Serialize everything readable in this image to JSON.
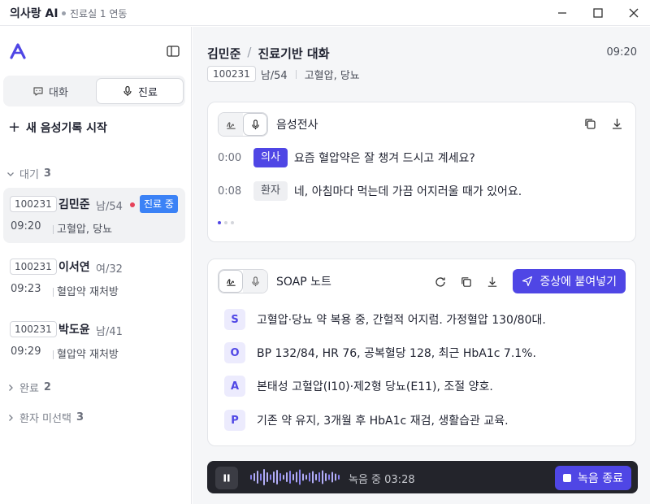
{
  "titlebar": {
    "app_name": "의사랑 AI",
    "location": "진료실 1 연동"
  },
  "sidebar": {
    "tabs": [
      {
        "label": "대화"
      },
      {
        "label": "진료"
      }
    ],
    "new_record_label": "새 음성기록 시작",
    "groups": {
      "waiting": {
        "label": "대기",
        "count": "3"
      },
      "done": {
        "label": "완료",
        "count": "2"
      },
      "unselected": {
        "label": "환자 미선택",
        "count": "3"
      }
    },
    "patients": [
      {
        "id": "100231",
        "name": "김민준",
        "meta": "남/54",
        "time": "09:20",
        "diag": "고혈압, 당뇨",
        "badge": "진료 중"
      },
      {
        "id": "100231",
        "name": "이서연",
        "meta": "여/32",
        "time": "09:23",
        "diag": "혈압약 재처방"
      },
      {
        "id": "100231",
        "name": "박도윤",
        "meta": "남/41",
        "time": "09:29",
        "diag": "혈압약 재처방"
      }
    ]
  },
  "header": {
    "patient_name": "김민준",
    "section": "진료기반 대화",
    "time": "09:20",
    "patient_id": "100231",
    "meta": "남/54",
    "diag": "고혈압, 당뇨"
  },
  "transcript": {
    "title": "음성전사",
    "lines": [
      {
        "time": "0:00",
        "speaker": "의사",
        "text": "요즘 혈압약은 잘 챙겨 드시고 계세요?"
      },
      {
        "time": "0:08",
        "speaker": "환자",
        "text": "네, 아침마다 먹는데 가끔 어지러울 때가 있어요."
      }
    ]
  },
  "soap": {
    "title": "SOAP 노트",
    "paste_label": "증상에 붙여넣기",
    "rows": [
      {
        "letter": "S",
        "text": "고혈압·당뇨 약 복용 중, 간헐적 어지럼. 가정혈압 130/80대."
      },
      {
        "letter": "O",
        "text": "BP 132/84, HR 76, 공복혈당 128, 최근 HbA1c 7.1%."
      },
      {
        "letter": "A",
        "text": "본태성 고혈압(I10)·제2형 당뇨(E11), 조절 양호."
      },
      {
        "letter": "P",
        "text": "기존 약 유지, 3개월 후 HbA1c 재검, 생활습관 교육."
      }
    ]
  },
  "recording": {
    "status": "녹음 중 03:28",
    "stop_label": "녹음 종료"
  },
  "colors": {
    "accent": "#4f46e5",
    "badge": "#3b82f6",
    "live_dot": "#e6435a",
    "recbar": "#23242b"
  }
}
